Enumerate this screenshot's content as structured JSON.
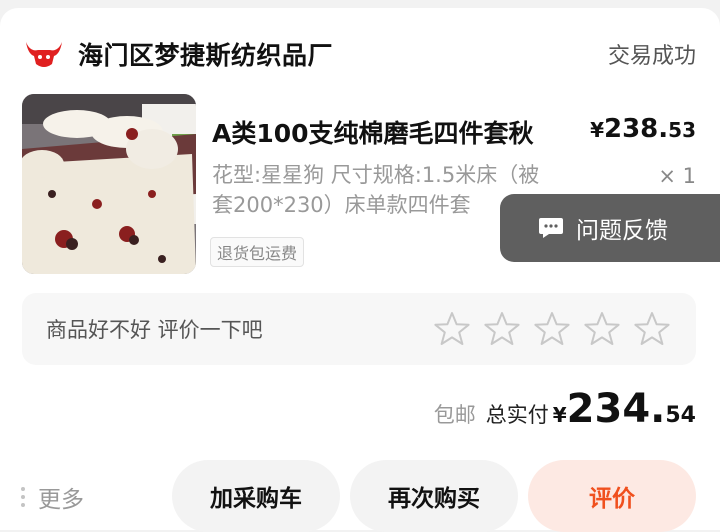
{
  "shop": {
    "name": "海门区梦捷斯纺织品厂",
    "logo_icon": "bull-head-icon",
    "brand_color": "#e02020"
  },
  "order": {
    "status": "交易成功"
  },
  "product": {
    "title": "A类100支纯棉磨毛四件套秋",
    "price_symbol": "¥",
    "price_integer": "238.",
    "price_decimal": "53",
    "spec": "花型:星星狗 尺寸规格:1.5米床（被套200*230）床单款四件套",
    "quantity": "× 1",
    "service_tag": "退货包运费",
    "image_icon": "bedding-set-photo"
  },
  "feedback": {
    "label": "问题反馈",
    "icon": "chat-bubble-icon"
  },
  "review": {
    "prompt": "商品好不好 评价一下吧",
    "stars_total": 5,
    "star_icon": "star-outline-icon"
  },
  "total": {
    "shipping": "包邮",
    "label": "总实付",
    "symbol": "¥",
    "integer": "234.",
    "decimal": "54"
  },
  "actions": {
    "more": "更多",
    "add_to_cart": "加采购车",
    "buy_again": "再次购买",
    "review": "评价",
    "accent_color": "#f0501e"
  }
}
